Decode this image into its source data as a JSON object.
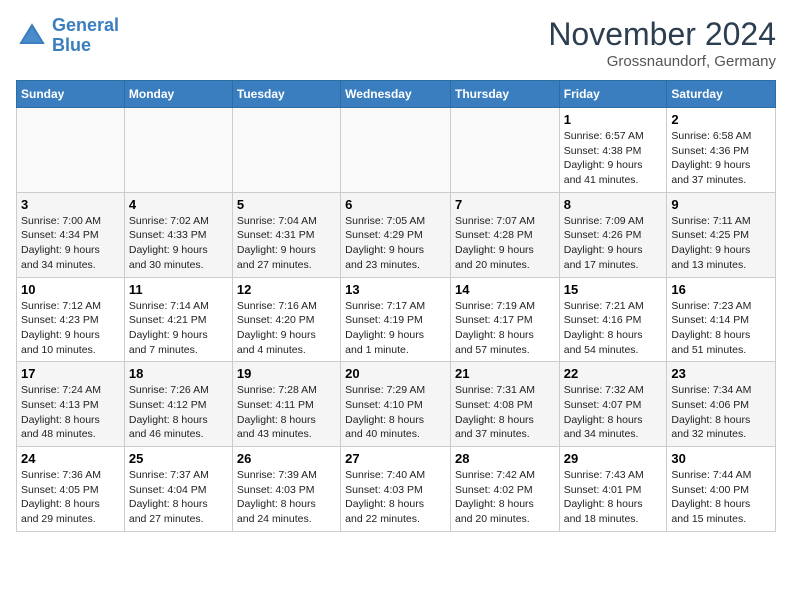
{
  "header": {
    "logo_line1": "General",
    "logo_line2": "Blue",
    "month": "November 2024",
    "location": "Grossnaundorf, Germany"
  },
  "weekdays": [
    "Sunday",
    "Monday",
    "Tuesday",
    "Wednesday",
    "Thursday",
    "Friday",
    "Saturday"
  ],
  "weeks": [
    [
      {
        "day": "",
        "detail": ""
      },
      {
        "day": "",
        "detail": ""
      },
      {
        "day": "",
        "detail": ""
      },
      {
        "day": "",
        "detail": ""
      },
      {
        "day": "",
        "detail": ""
      },
      {
        "day": "1",
        "detail": "Sunrise: 6:57 AM\nSunset: 4:38 PM\nDaylight: 9 hours\nand 41 minutes."
      },
      {
        "day": "2",
        "detail": "Sunrise: 6:58 AM\nSunset: 4:36 PM\nDaylight: 9 hours\nand 37 minutes."
      }
    ],
    [
      {
        "day": "3",
        "detail": "Sunrise: 7:00 AM\nSunset: 4:34 PM\nDaylight: 9 hours\nand 34 minutes."
      },
      {
        "day": "4",
        "detail": "Sunrise: 7:02 AM\nSunset: 4:33 PM\nDaylight: 9 hours\nand 30 minutes."
      },
      {
        "day": "5",
        "detail": "Sunrise: 7:04 AM\nSunset: 4:31 PM\nDaylight: 9 hours\nand 27 minutes."
      },
      {
        "day": "6",
        "detail": "Sunrise: 7:05 AM\nSunset: 4:29 PM\nDaylight: 9 hours\nand 23 minutes."
      },
      {
        "day": "7",
        "detail": "Sunrise: 7:07 AM\nSunset: 4:28 PM\nDaylight: 9 hours\nand 20 minutes."
      },
      {
        "day": "8",
        "detail": "Sunrise: 7:09 AM\nSunset: 4:26 PM\nDaylight: 9 hours\nand 17 minutes."
      },
      {
        "day": "9",
        "detail": "Sunrise: 7:11 AM\nSunset: 4:25 PM\nDaylight: 9 hours\nand 13 minutes."
      }
    ],
    [
      {
        "day": "10",
        "detail": "Sunrise: 7:12 AM\nSunset: 4:23 PM\nDaylight: 9 hours\nand 10 minutes."
      },
      {
        "day": "11",
        "detail": "Sunrise: 7:14 AM\nSunset: 4:21 PM\nDaylight: 9 hours\nand 7 minutes."
      },
      {
        "day": "12",
        "detail": "Sunrise: 7:16 AM\nSunset: 4:20 PM\nDaylight: 9 hours\nand 4 minutes."
      },
      {
        "day": "13",
        "detail": "Sunrise: 7:17 AM\nSunset: 4:19 PM\nDaylight: 9 hours\nand 1 minute."
      },
      {
        "day": "14",
        "detail": "Sunrise: 7:19 AM\nSunset: 4:17 PM\nDaylight: 8 hours\nand 57 minutes."
      },
      {
        "day": "15",
        "detail": "Sunrise: 7:21 AM\nSunset: 4:16 PM\nDaylight: 8 hours\nand 54 minutes."
      },
      {
        "day": "16",
        "detail": "Sunrise: 7:23 AM\nSunset: 4:14 PM\nDaylight: 8 hours\nand 51 minutes."
      }
    ],
    [
      {
        "day": "17",
        "detail": "Sunrise: 7:24 AM\nSunset: 4:13 PM\nDaylight: 8 hours\nand 48 minutes."
      },
      {
        "day": "18",
        "detail": "Sunrise: 7:26 AM\nSunset: 4:12 PM\nDaylight: 8 hours\nand 46 minutes."
      },
      {
        "day": "19",
        "detail": "Sunrise: 7:28 AM\nSunset: 4:11 PM\nDaylight: 8 hours\nand 43 minutes."
      },
      {
        "day": "20",
        "detail": "Sunrise: 7:29 AM\nSunset: 4:10 PM\nDaylight: 8 hours\nand 40 minutes."
      },
      {
        "day": "21",
        "detail": "Sunrise: 7:31 AM\nSunset: 4:08 PM\nDaylight: 8 hours\nand 37 minutes."
      },
      {
        "day": "22",
        "detail": "Sunrise: 7:32 AM\nSunset: 4:07 PM\nDaylight: 8 hours\nand 34 minutes."
      },
      {
        "day": "23",
        "detail": "Sunrise: 7:34 AM\nSunset: 4:06 PM\nDaylight: 8 hours\nand 32 minutes."
      }
    ],
    [
      {
        "day": "24",
        "detail": "Sunrise: 7:36 AM\nSunset: 4:05 PM\nDaylight: 8 hours\nand 29 minutes."
      },
      {
        "day": "25",
        "detail": "Sunrise: 7:37 AM\nSunset: 4:04 PM\nDaylight: 8 hours\nand 27 minutes."
      },
      {
        "day": "26",
        "detail": "Sunrise: 7:39 AM\nSunset: 4:03 PM\nDaylight: 8 hours\nand 24 minutes."
      },
      {
        "day": "27",
        "detail": "Sunrise: 7:40 AM\nSunset: 4:03 PM\nDaylight: 8 hours\nand 22 minutes."
      },
      {
        "day": "28",
        "detail": "Sunrise: 7:42 AM\nSunset: 4:02 PM\nDaylight: 8 hours\nand 20 minutes."
      },
      {
        "day": "29",
        "detail": "Sunrise: 7:43 AM\nSunset: 4:01 PM\nDaylight: 8 hours\nand 18 minutes."
      },
      {
        "day": "30",
        "detail": "Sunrise: 7:44 AM\nSunset: 4:00 PM\nDaylight: 8 hours\nand 15 minutes."
      }
    ]
  ]
}
